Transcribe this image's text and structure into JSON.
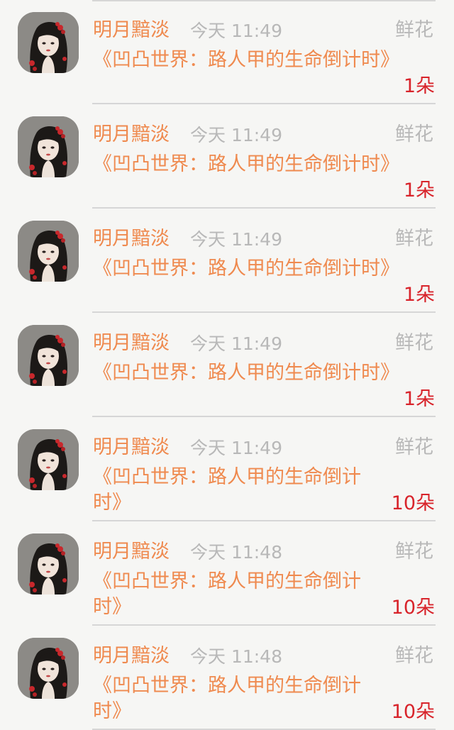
{
  "messages": [
    {
      "sender": "明月黯淡",
      "time": "今天 11:49",
      "gift_type": "鲜花",
      "title": "《凹凸世界：路人甲的生命倒计时》",
      "count": "1朵"
    },
    {
      "sender": "明月黯淡",
      "time": "今天 11:49",
      "gift_type": "鲜花",
      "title": "《凹凸世界：路人甲的生命倒计时》",
      "count": "1朵"
    },
    {
      "sender": "明月黯淡",
      "time": "今天 11:49",
      "gift_type": "鲜花",
      "title": "《凹凸世界：路人甲的生命倒计时》",
      "count": "1朵"
    },
    {
      "sender": "明月黯淡",
      "time": "今天 11:49",
      "gift_type": "鲜花",
      "title": "《凹凸世界：路人甲的生命倒计时》",
      "count": "1朵"
    },
    {
      "sender": "明月黯淡",
      "time": "今天 11:49",
      "gift_type": "鲜花",
      "title": "《凹凸世界：路人甲的生命倒计时》",
      "count": "10朵"
    },
    {
      "sender": "明月黯淡",
      "time": "今天 11:48",
      "gift_type": "鲜花",
      "title": "《凹凸世界：路人甲的生命倒计时》",
      "count": "10朵"
    },
    {
      "sender": "明月黯淡",
      "time": "今天 11:48",
      "gift_type": "鲜花",
      "title": "《凹凸世界：路人甲的生命倒计时》",
      "count": "10朵"
    }
  ]
}
